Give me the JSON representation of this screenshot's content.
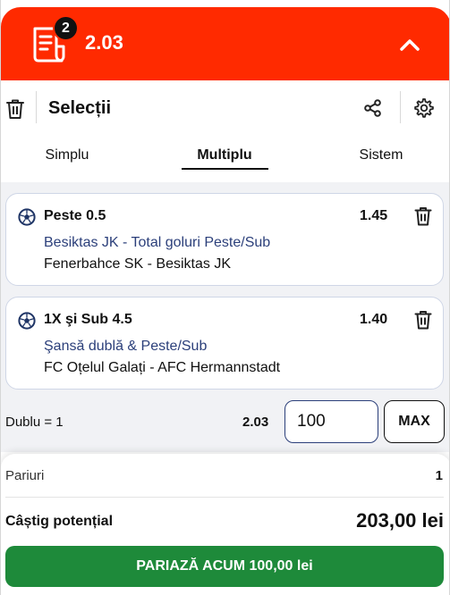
{
  "header": {
    "selection_count": "2",
    "total_odds": "2.03",
    "color": "#ff2a00"
  },
  "title_bar": {
    "title": "Selecții"
  },
  "tabs": [
    {
      "label": "Simplu",
      "active": false
    },
    {
      "label": "Multiplu",
      "active": true
    },
    {
      "label": "Sistem",
      "active": false
    }
  ],
  "selections": [
    {
      "name": "Peste 0.5",
      "odds": "1.45",
      "market": "Besiktas JK - Total goluri Peste/Sub",
      "event": "Fenerbahce SK - Besiktas JK",
      "icon": "soccer-ball-icon"
    },
    {
      "name": "1X şi Sub 4.5",
      "odds": "1.40",
      "market": "Şansă dublă & Peste/Sub",
      "event": "FC Oțelul Galați - AFC Hermannstadt",
      "icon": "soccer-ball-icon"
    }
  ],
  "stake": {
    "label": "Dublu = 1",
    "odds": "2.03",
    "value": "100",
    "max_label": "MAX"
  },
  "summary": {
    "bets_label": "Pariuri",
    "bets_value": "1",
    "potential_label": "Câștig potențial",
    "potential_value": "203,00 lei"
  },
  "place_bet": {
    "label": "PARIAZĂ ACUM 100,00 lei",
    "color": "#1e8a3a"
  }
}
